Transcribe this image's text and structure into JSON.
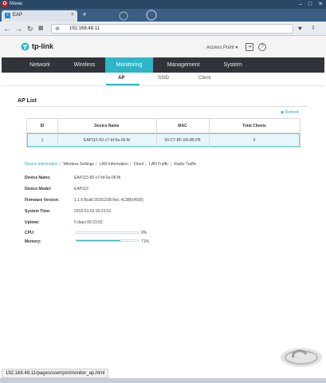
{
  "browser": {
    "menu_label": "Меню",
    "tab_title": "EAP",
    "tab_close": "×",
    "new_tab": "+",
    "url": "192.168.48.11",
    "status_url": "192.168.48.11/pages/userrpm/monitor_ap.html"
  },
  "header": {
    "logo_text": "tp-link",
    "mode_label": "Access Point",
    "logout_icon": "logout-icon",
    "help_icon": "help-icon"
  },
  "main_nav": [
    "Network",
    "Wireless",
    "Monitoring",
    "Management",
    "System"
  ],
  "main_nav_active": "Monitoring",
  "sub_nav": [
    "AP",
    "SSID",
    "Client"
  ],
  "sub_nav_active": "AP",
  "ap_list": {
    "title": "AP List",
    "refresh_label": "Refresh",
    "columns": [
      "ID",
      "Device Name",
      "MAC",
      "Total Clients"
    ],
    "rows": [
      {
        "id": "1",
        "device_name": "EAP115-50-c7-bf-0a-06-fb",
        "mac": "50-C7-BF-0A-0B-FB",
        "clients": "0"
      }
    ]
  },
  "detail_tabs": [
    "Device Information",
    "Wireless Settings",
    "LAN Information",
    "Client",
    "LAN Traffic",
    "Radio Traffic"
  ],
  "detail_tabs_active": "Device Information",
  "device_info": {
    "device_name_label": "Device Name:",
    "device_name": "EAP115-50-c7-bf-0a-06-fb",
    "device_model_label": "Device Model:",
    "device_model": "EAP115",
    "firmware_label": "Firmware Version:",
    "firmware": "1.1.0 Build 20161108 Rel. 41386(4555)",
    "system_time_label": "System Time:",
    "system_time": "2016-01-01 00:23:51",
    "uptime_label": "Uptime:",
    "uptime": "0 days 00:23:52",
    "cpu_label": "CPU:",
    "cpu_percent": 0,
    "cpu_text": "0%",
    "memory_label": "Memory:",
    "memory_percent": 71,
    "memory_text": "71%"
  },
  "colors": {
    "accent": "#2fb5c7",
    "nav_bg": "#30343a",
    "browser_frame": "#2a4766"
  }
}
